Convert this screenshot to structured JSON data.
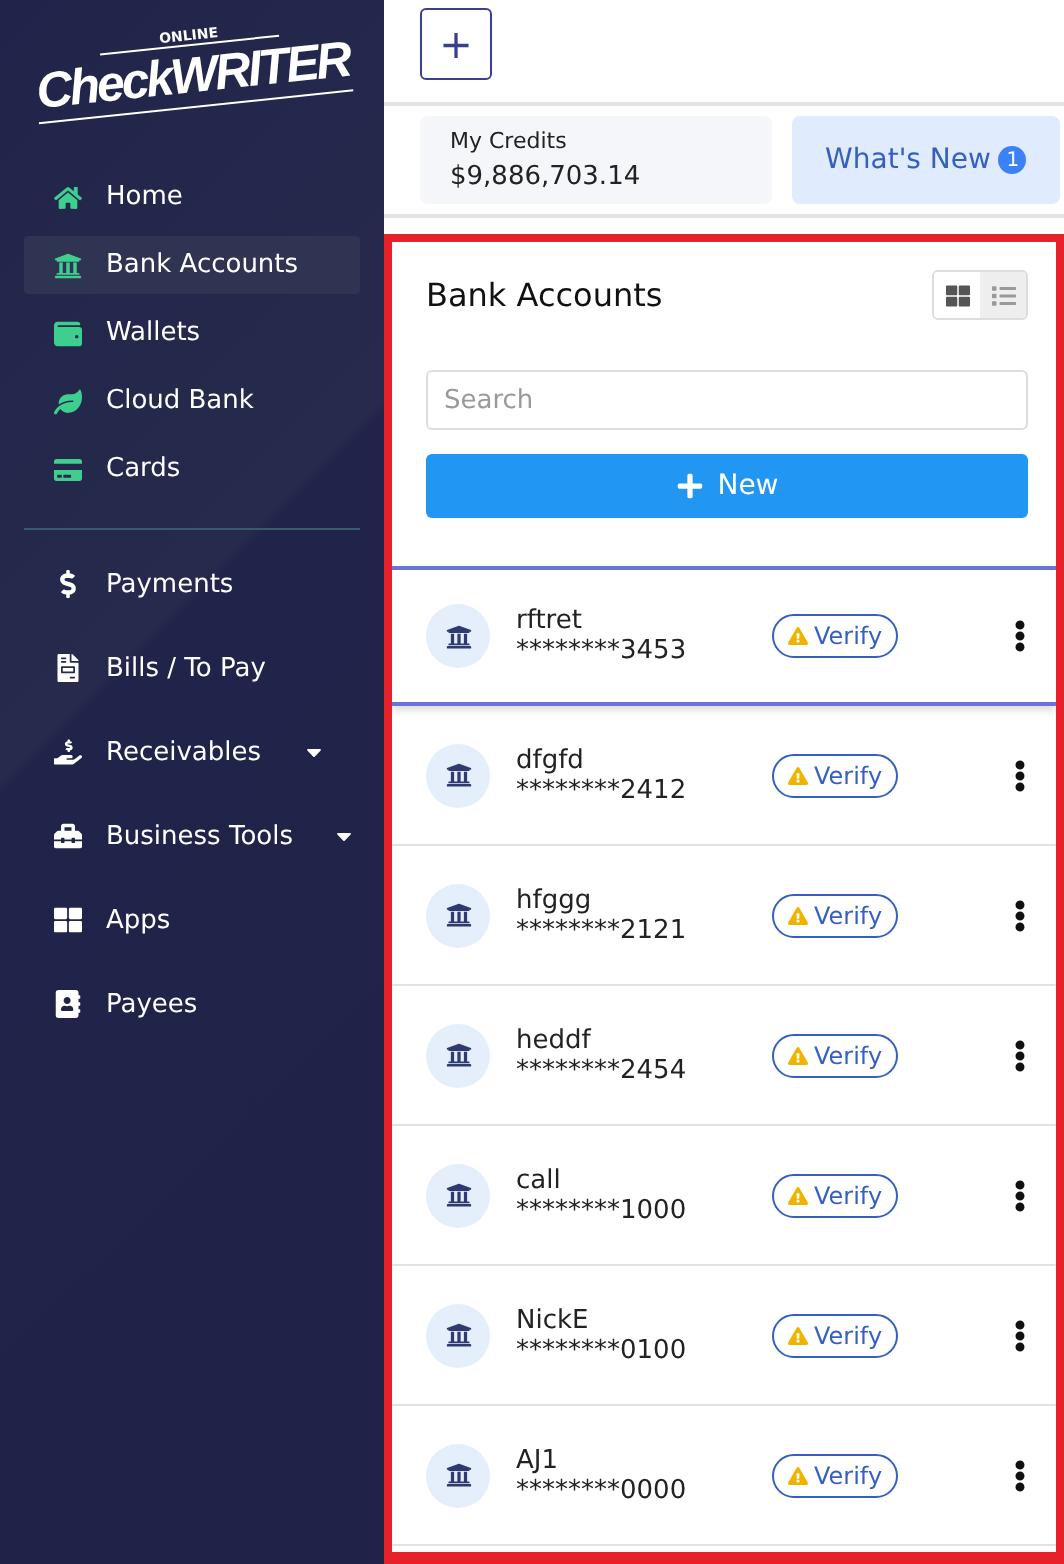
{
  "logo": {
    "small": "ONLINE",
    "main": "CheckWRITER"
  },
  "sidebar": {
    "groups": [
      {
        "items": [
          {
            "label": "Home",
            "selected": false,
            "expandable": false
          },
          {
            "label": "Bank Accounts",
            "selected": true,
            "expandable": false
          },
          {
            "label": "Wallets",
            "selected": false,
            "expandable": false
          },
          {
            "label": "Cloud Bank",
            "selected": false,
            "expandable": false
          },
          {
            "label": "Cards",
            "selected": false,
            "expandable": false
          }
        ]
      },
      {
        "items": [
          {
            "label": "Payments",
            "selected": false,
            "expandable": false
          },
          {
            "label": "Bills / To Pay",
            "selected": false,
            "expandable": false
          },
          {
            "label": "Receivables",
            "selected": false,
            "expandable": true
          },
          {
            "label": "Business Tools",
            "selected": false,
            "expandable": true
          },
          {
            "label": "Apps",
            "selected": false,
            "expandable": false
          },
          {
            "label": "Payees",
            "selected": false,
            "expandable": false
          }
        ]
      }
    ]
  },
  "topbar": {
    "add_button": "+"
  },
  "credits": {
    "label": "My Credits",
    "amount": "$9,886,703.14"
  },
  "whats_new": {
    "label": "What's New",
    "badge": "1"
  },
  "panel": {
    "title": "Bank Accounts",
    "view_toggle": [
      {
        "selected": false
      },
      {
        "selected": true
      }
    ],
    "search": {
      "placeholder": "Search"
    },
    "new_button": "New",
    "accounts": [
      {
        "name": "rftret",
        "number": "********3453",
        "action": "Verify",
        "selected": true
      },
      {
        "name": "dfgfd",
        "number": "********2412",
        "action": "Verify",
        "selected": false
      },
      {
        "name": "hfggg",
        "number": "********2121",
        "action": "Verify",
        "selected": false
      },
      {
        "name": "heddf",
        "number": "********2454",
        "action": "Verify",
        "selected": false
      },
      {
        "name": "call",
        "number": "********1000",
        "action": "Verify",
        "selected": false
      },
      {
        "name": "NickE",
        "number": "********0100",
        "action": "Verify",
        "selected": false
      },
      {
        "name": "AJ1",
        "number": "********0000",
        "action": "Verify",
        "selected": false
      }
    ]
  }
}
